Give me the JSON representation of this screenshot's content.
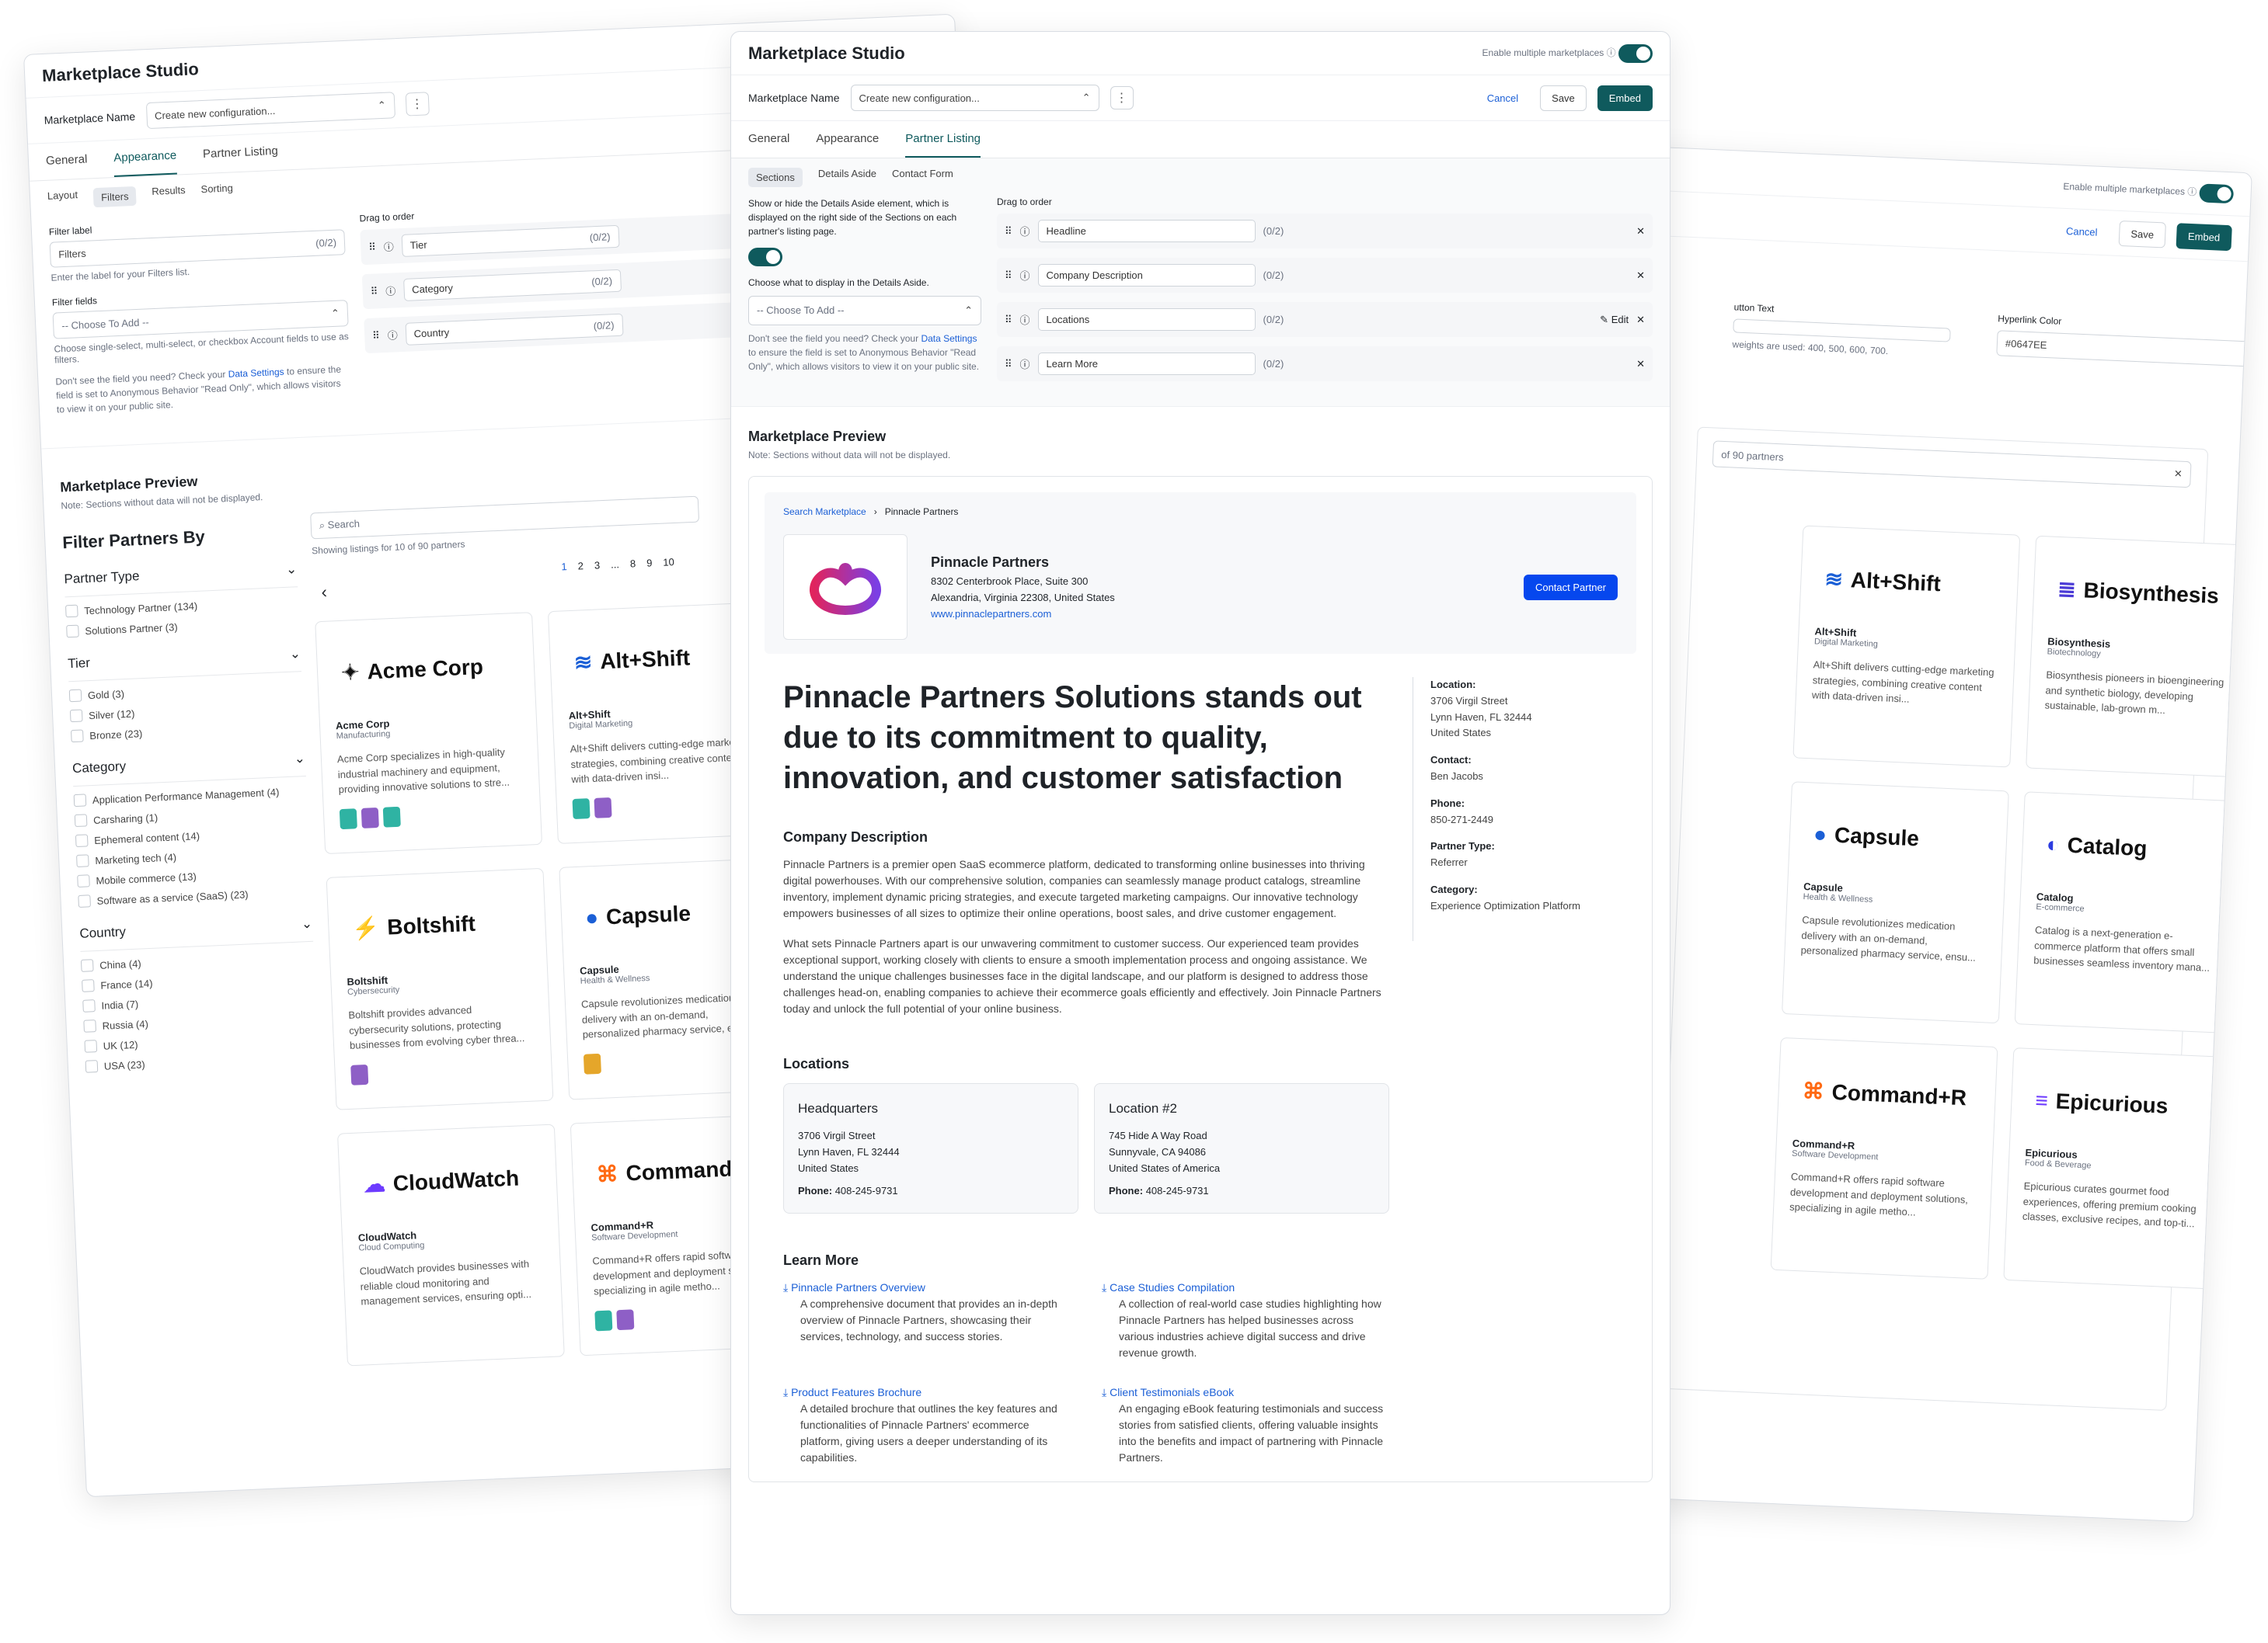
{
  "app": {
    "title": "Marketplace Studio",
    "enable_multi": "Enable multiple marketplaces",
    "info": "ⓘ"
  },
  "toolbar": {
    "name_label": "Marketplace Name",
    "name_value": "Create new configuration...",
    "cancel": "Cancel",
    "save": "Save",
    "embed": "Embed"
  },
  "tabs": [
    "General",
    "Appearance",
    "Partner Listing"
  ],
  "left": {
    "subtabs": [
      "Layout",
      "Filters",
      "Results",
      "Sorting"
    ],
    "filter_label": "Filter label",
    "filter_value": "Filters",
    "filter_hint": "Enter the label for your Filters list.",
    "filter_fields": "Filter fields",
    "choose": "-- Choose To Add --",
    "fields_hint": "Choose single-select, multi-select, or checkbox Account fields to use as filters.",
    "help_a": "Don't see the field you need? Check your ",
    "help_link": "Data Settings",
    "help_b": " to ensure the field is set to Anonymous Behavior \"Read Only\", which allows visitors to view it on your public site.",
    "drag": "Drag to order",
    "rows": [
      "Tier",
      "Category",
      "Country"
    ],
    "count": "(0/2)",
    "preview_title": "Marketplace Preview",
    "preview_note": "Note: Sections without data will not be displayed.",
    "filter_by": "Filter Partners By",
    "groups": [
      {
        "name": "Partner Type",
        "items": [
          "Technology Partner (134)",
          "Solutions Partner (3)"
        ]
      },
      {
        "name": "Tier",
        "items": [
          "Gold (3)",
          "Silver (12)",
          "Bronze (23)"
        ]
      },
      {
        "name": "Category",
        "items": [
          "Application Performance Management (4)",
          "Carsharing (1)",
          "Ephemeral content (14)",
          "Marketing tech (4)",
          "Mobile commerce (13)",
          "Software as a service (SaaS) (23)"
        ]
      },
      {
        "name": "Country",
        "items": [
          "China (4)",
          "France (14)",
          "India (7)",
          "Russia (4)",
          "UK (12)",
          "USA (23)"
        ]
      }
    ],
    "search": "Search",
    "showing": "Showing listings for 10 of 90 partners",
    "pages": [
      "1",
      "2",
      "3",
      "...",
      "8",
      "9",
      "10"
    ]
  },
  "partners": [
    {
      "name": "Acme Corp",
      "cat": "Manufacturing",
      "desc": "Acme Corp specializes in high-quality industrial machinery and equipment, providing innovative solutions to stre...",
      "icon": "star-icon",
      "color": "#111111"
    },
    {
      "name": "Alt+Shift",
      "cat": "Digital Marketing",
      "desc": "Alt+Shift delivers cutting-edge marketing strategies, combining creative content with data-driven insi...",
      "icon": "waves-icon",
      "color": "#1b5fd6"
    },
    {
      "name": "Boltshift",
      "cat": "Cybersecurity",
      "desc": "Boltshift provides advanced cybersecurity solutions, protecting businesses from evolving cyber threa...",
      "icon": "bolt-icon",
      "color": "#1b5fd6"
    },
    {
      "name": "Capsule",
      "cat": "Health & Wellness",
      "desc": "Capsule revolutionizes medication delivery with an on-demand, personalized pharmacy service, ensu...",
      "icon": "capsule-icon",
      "color": "#1b5fd6"
    },
    {
      "name": "CloudWatch",
      "cat": "Cloud Computing",
      "desc": "CloudWatch provides businesses with reliable cloud monitoring and management services, ensuring opti...",
      "icon": "cloud-icon",
      "color": "#6d3bff"
    },
    {
      "name": "Command+R",
      "cat": "Software Development",
      "desc": "Command+R offers rapid software development and deployment solutions, specializing in agile metho...",
      "icon": "command-icon",
      "color": "#ff6a13"
    },
    {
      "name": "Biosynthesis",
      "cat": "Biotechnology",
      "desc": "Biosynthesis pioneers in bioengineering and synthetic biology, developing sustainable, lab-grown m...",
      "icon": "bio-icon",
      "color": "#4b3bd6"
    },
    {
      "name": "Catalog",
      "cat": "E-commerce",
      "desc": "Catalog is a next-generation e-commerce platform that offers small businesses seamless inventory mana...",
      "icon": "catalog-icon",
      "color": "#2b3be0"
    },
    {
      "name": "Epicurious",
      "cat": "Food & Beverage",
      "desc": "Epicurious curates gourmet food experiences, offering premium cooking classes, exclusive recipes, and top-ti...",
      "icon": "epicurious-icon",
      "color": "#6d3bff"
    }
  ],
  "right": {
    "button_text": "utton Text",
    "hyperlink_color": "Hyperlink Color",
    "hex": "#0647EE",
    "weights": "weights are used: 400, 500, 600, 700.",
    "partners_note": "of 90 partners",
    "close": "✕"
  },
  "center": {
    "subtabs": [
      "Sections",
      "Details Aside",
      "Contact Form"
    ],
    "aside_help": "Show or hide the Details Aside element, which is displayed on the right side of the Sections on each partner's listing page.",
    "aside_choose_label": "Choose what to display in the Details Aside.",
    "choose": "-- Choose To Add --",
    "help_a": "Don't see the field you need? Check your ",
    "help_link": "Data Settings",
    "help_b": " to ensure the field is set to Anonymous Behavior \"Read Only\", which allows visitors to view it on your public site.",
    "drag": "Drag to order",
    "rows": [
      "Headline",
      "Company Description",
      "Locations",
      "Learn More"
    ],
    "count": "(0/2)",
    "edit": "Edit",
    "remove": "✕",
    "preview_title": "Marketplace Preview",
    "preview_note": "Note: Sections without data will not be displayed.",
    "crumb_root": "Search Marketplace",
    "crumb_current": "Pinnacle Partners",
    "company": "Pinnacle Partners",
    "addr1": "8302 Centerbrook Place, Suite 300",
    "addr2": "Alexandria, Virginia 22308, United States",
    "website": "www.pinnaclepartners.com",
    "contact_btn": "Contact Partner",
    "headline": "Pinnacle Partners Solutions stands out due to its commitment to quality, innovation, and customer satisfaction",
    "desc_title": "Company Description",
    "desc_p1": "Pinnacle Partners is a premier open SaaS ecommerce platform, dedicated to transforming online businesses into thriving digital powerhouses. With our comprehensive solution, companies can seamlessly manage product catalogs, streamline inventory, implement dynamic pricing strategies, and execute targeted marketing campaigns. Our innovative technology empowers businesses of all sizes to optimize their online operations, boost sales, and drive customer engagement.",
    "desc_p2": "What sets Pinnacle Partners apart is our unwavering commitment to customer success. Our experienced team provides exceptional support, working closely with clients to ensure a smooth implementation process and ongoing assistance. We understand the unique challenges businesses face in the digital landscape, and our platform is designed to address those challenges head-on, enabling companies to achieve their ecommerce goals efficiently and effectively. Join Pinnacle Partners today and unlock the full potential of your online business.",
    "aside": [
      {
        "label": "Location:",
        "value": "3706 Virgil Street\nLynn Haven, FL 32444\nUnited States"
      },
      {
        "label": "Contact:",
        "value": "Ben Jacobs"
      },
      {
        "label": "Phone:",
        "value": "850-271-2449"
      },
      {
        "label": "Partner Type:",
        "value": "Referrer"
      },
      {
        "label": "Category:",
        "value": "Experience Optimization Platform"
      }
    ],
    "locations_title": "Locations",
    "locations": [
      {
        "name": "Headquarters",
        "l1": "3706 Virgil Street",
        "l2": "Lynn Haven, FL 32444",
        "l3": "United States",
        "phone_label": "Phone:",
        "phone": "408-245-9731"
      },
      {
        "name": "Location #2",
        "l1": "745 Hide A Way Road",
        "l2": "Sunnyvale, CA 94086",
        "l3": "United States of America",
        "phone_label": "Phone:",
        "phone": "408-245-9731"
      }
    ],
    "learn_title": "Learn More",
    "learn": [
      {
        "title": "Pinnacle Partners Overview",
        "desc": "A comprehensive document that provides an in-depth overview of Pinnacle Partners, showcasing their services, technology, and success stories."
      },
      {
        "title": "Case Studies Compilation",
        "desc": "A collection of real-world case studies highlighting how Pinnacle Partners has helped businesses across various industries achieve digital success and drive revenue growth."
      },
      {
        "title": "Product Features Brochure",
        "desc": "A detailed brochure that outlines the key features and functionalities of Pinnacle Partners' ecommerce platform, giving users a deeper understanding of its capabilities."
      },
      {
        "title": "Client Testimonials eBook",
        "desc": "An engaging eBook featuring testimonials and success stories from satisfied clients, offering valuable insights into the benefits and impact of partnering with Pinnacle Partners."
      }
    ]
  }
}
